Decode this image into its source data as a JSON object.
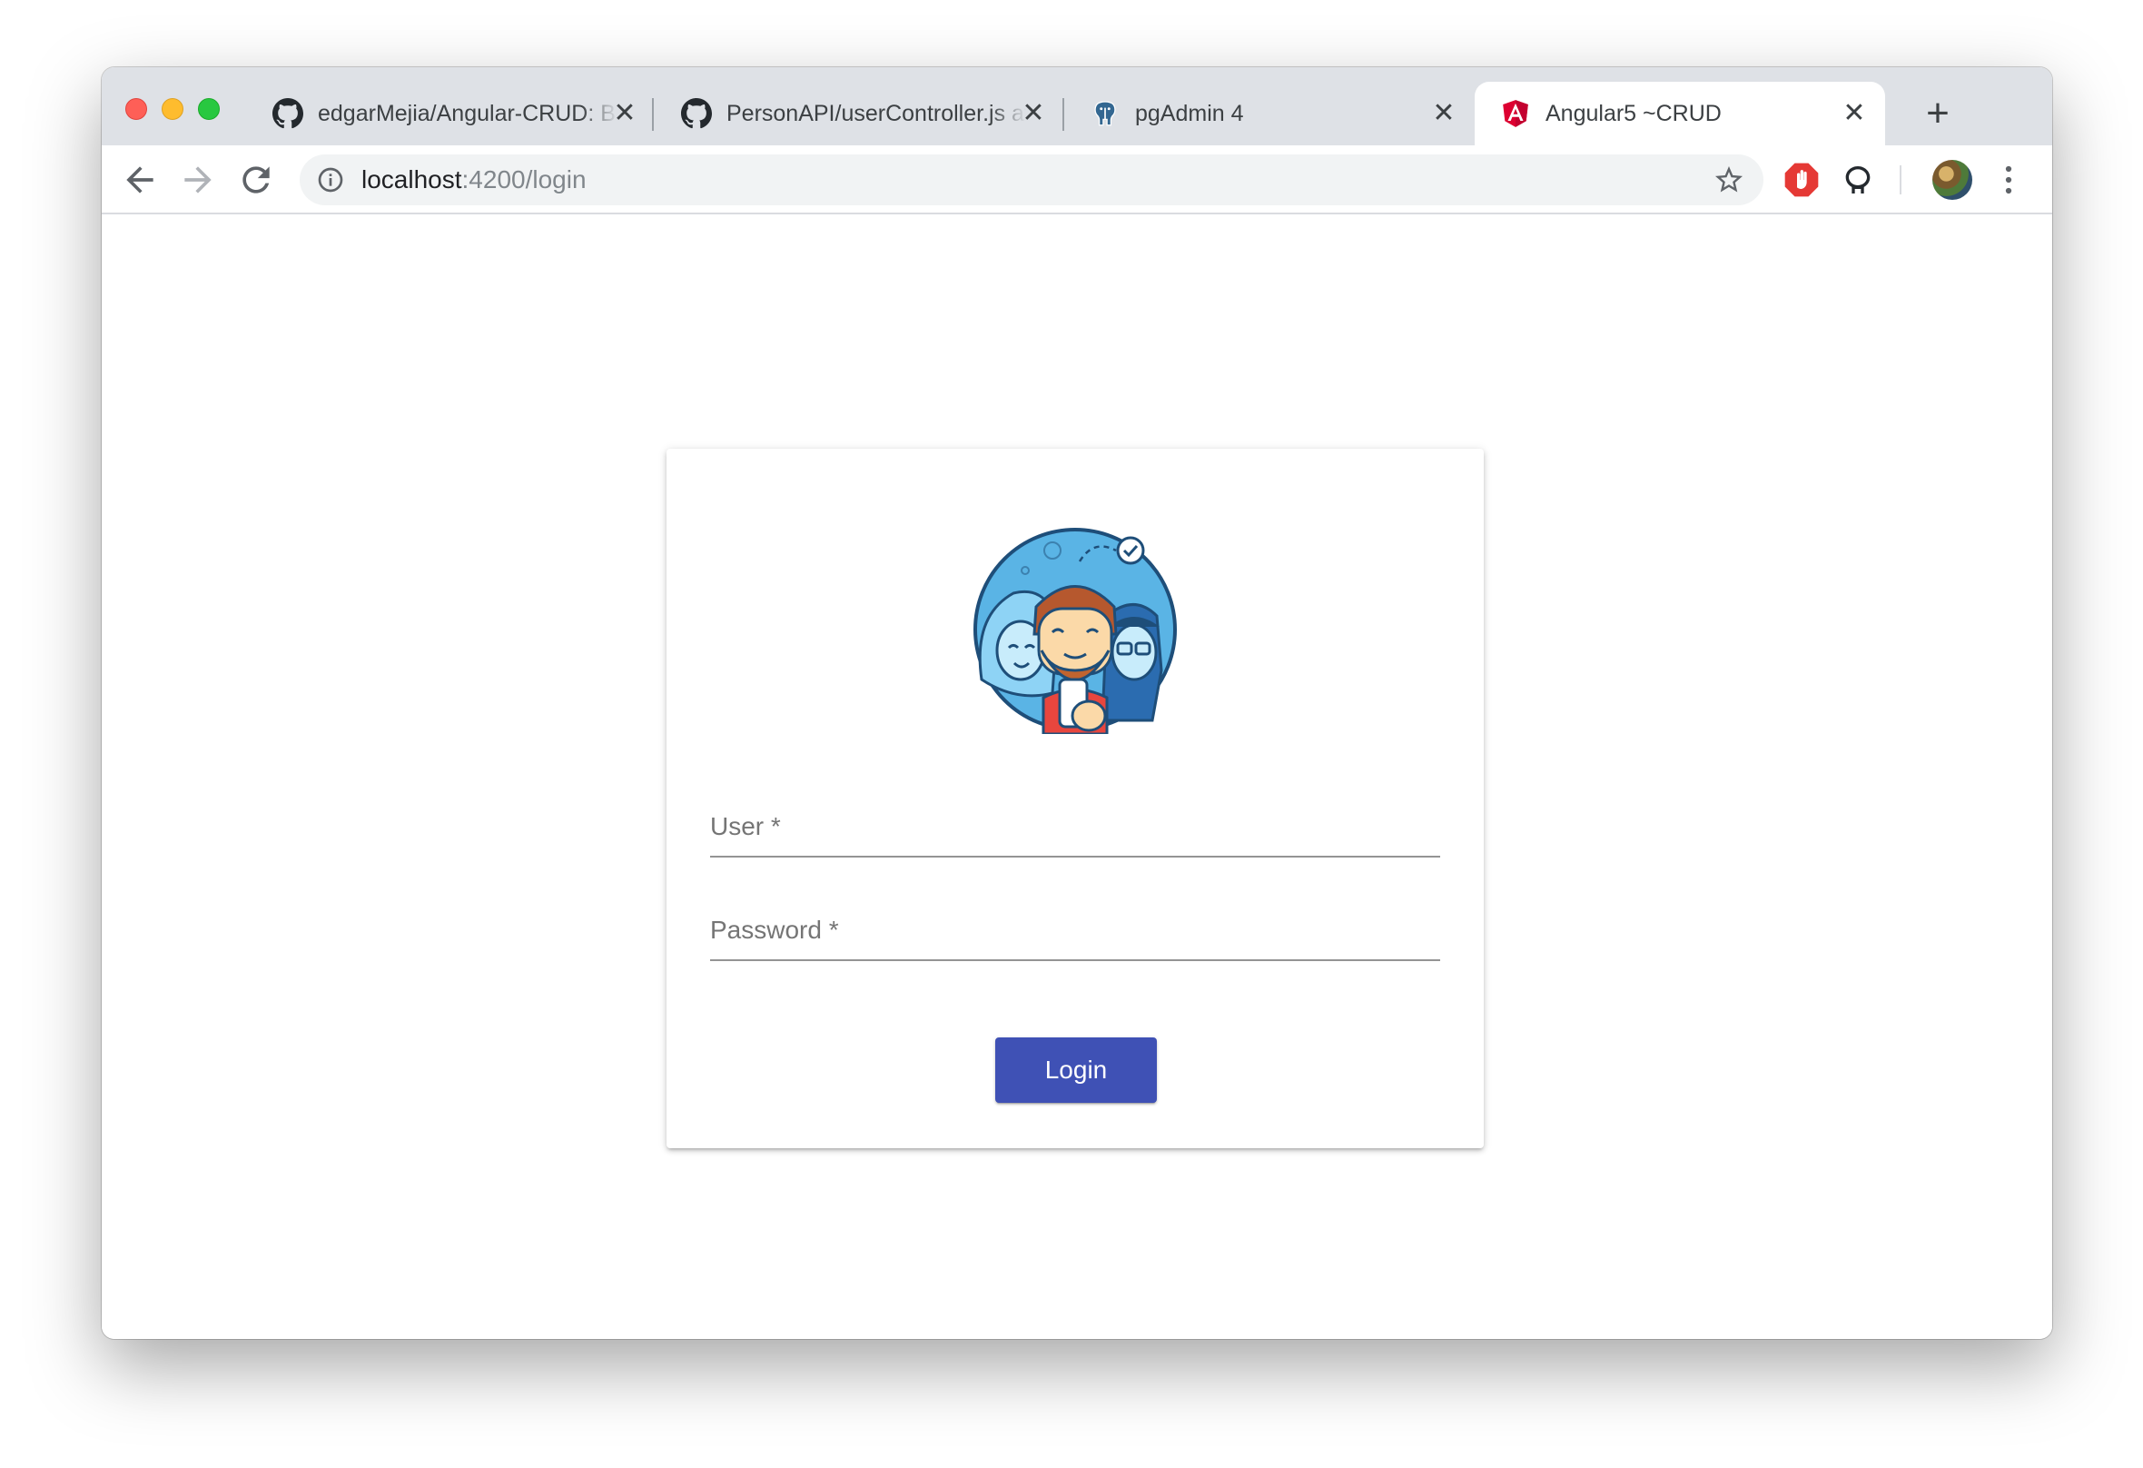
{
  "browser": {
    "tabs": [
      {
        "title": "edgarMejia/Angular-CRUD: Bas",
        "favicon": "github-icon",
        "active": false
      },
      {
        "title": "PersonAPI/userController.js at",
        "favicon": "github-icon",
        "active": false
      },
      {
        "title": "pgAdmin 4",
        "favicon": "postgres-elephant-icon",
        "active": false
      },
      {
        "title": "Angular5 ~CRUD",
        "favicon": "angular-icon",
        "active": true
      }
    ],
    "close_glyph": "✕",
    "new_tab_glyph": "+",
    "url_host": "localhost",
    "url_path": ":4200/login"
  },
  "login": {
    "user_label": "User *",
    "password_label": "Password *",
    "button_label": "Login"
  },
  "colors": {
    "primary": "#3f51b5",
    "tabstrip": "#dee1e6",
    "omnibox": "#f1f3f4"
  }
}
